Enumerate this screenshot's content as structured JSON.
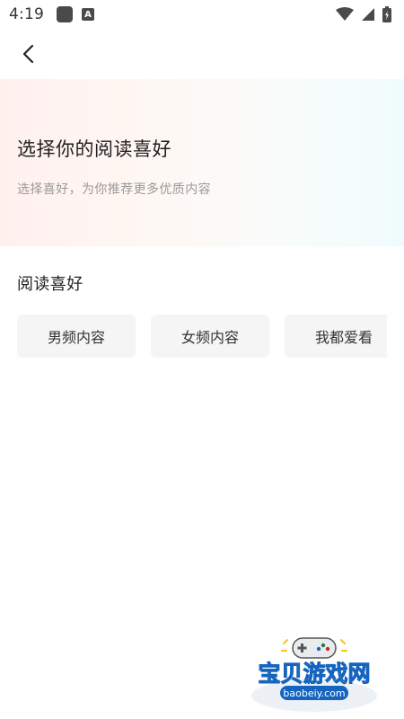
{
  "status_bar": {
    "time": "4:19",
    "a_glyph": "A"
  },
  "header": {
    "title": "选择你的阅读喜好",
    "subtitle": "选择喜好，为你推荐更多优质内容"
  },
  "preferences": {
    "section_title": "阅读喜好",
    "options": [
      {
        "label": "男频内容"
      },
      {
        "label": "女频内容"
      },
      {
        "label": "我都爱看"
      }
    ]
  },
  "watermark": {
    "text": "宝贝游戏网",
    "url": "baobeiy.com"
  },
  "colors": {
    "hero_left": "#fff0ee",
    "hero_right": "#f0fcfc",
    "chip_bg": "#f5f5f5",
    "watermark_blue": "#1565c0",
    "watermark_yellow": "#f5c518"
  },
  "icons": {
    "back": "chevron-left-icon",
    "wifi": "wifi-icon",
    "signal": "signal-icon",
    "battery": "battery-icon"
  }
}
